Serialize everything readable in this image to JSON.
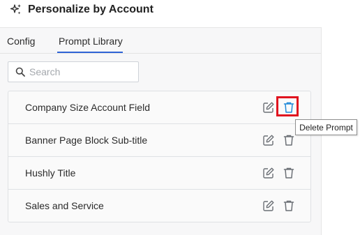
{
  "header": {
    "title": "Personalize by Account",
    "icon": "sparkle-icon"
  },
  "tabs": [
    {
      "label": "Config",
      "active": false
    },
    {
      "label": "Prompt Library",
      "active": true
    }
  ],
  "search": {
    "placeholder": "Search",
    "value": ""
  },
  "prompts": [
    {
      "label": "Company Size Account Field",
      "delete_highlighted": true
    },
    {
      "label": "Banner Page Block Sub-title",
      "delete_highlighted": false
    },
    {
      "label": "Hushly Title",
      "delete_highlighted": false
    },
    {
      "label": "Sales and Service",
      "delete_highlighted": false
    }
  ],
  "tooltip": {
    "text": "Delete Prompt"
  },
  "colors": {
    "accent": "#2f64d6",
    "highlight": "#e0141f",
    "active_icon": "#1e88d8",
    "icon": "#6b6f75"
  }
}
